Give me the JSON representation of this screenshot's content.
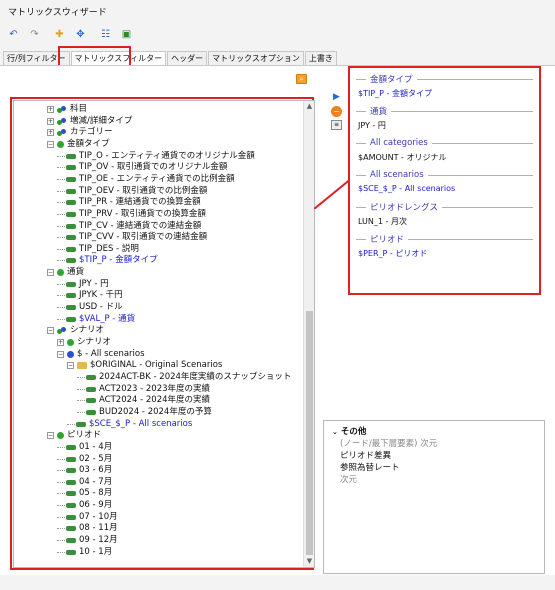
{
  "window": {
    "title": "マトリックスウィザード"
  },
  "toolbar": [
    {
      "name": "undo-icon",
      "glyph": "↶",
      "color": "#2a6ad0"
    },
    {
      "name": "redo-icon",
      "glyph": "↷",
      "color": "#888888"
    },
    {
      "name": "add-member-icon",
      "glyph": "✚",
      "color": "#e0a020"
    },
    {
      "name": "member-select-icon",
      "glyph": "✥",
      "color": "#2a6ad0"
    },
    {
      "name": "list-view-icon",
      "glyph": "☷",
      "color": "#2a6ad0"
    },
    {
      "name": "export-icon",
      "glyph": "▣",
      "color": "#2a8a2a"
    }
  ],
  "tabs": [
    {
      "label": "行/列フィルター",
      "active": false
    },
    {
      "label": "マトリックスフィルター",
      "active": true
    },
    {
      "label": "ヘッダー",
      "active": false
    },
    {
      "label": "マトリックスオプション",
      "active": false
    },
    {
      "label": "上書き",
      "active": false
    }
  ],
  "tree": {
    "rows": [
      {
        "level": 0,
        "exp": "⊞",
        "icon": "multi",
        "label": "科目",
        "blue": false
      },
      {
        "level": 0,
        "exp": "⊞",
        "icon": "multi",
        "label": "増減/詳細タイプ",
        "blue": false
      },
      {
        "level": 0,
        "exp": "⊞",
        "icon": "multi",
        "label": "カテゴリー",
        "blue": false
      },
      {
        "level": 0,
        "exp": "⊟",
        "icon": "ball",
        "label": "金額タイプ",
        "blue": false
      },
      {
        "level": 1,
        "exp": "",
        "icon": "leaf",
        "label": "TIP_O - エンティティ通貨でのオリジナル金額",
        "blue": false
      },
      {
        "level": 1,
        "exp": "",
        "icon": "leaf",
        "label": "TIP_OV - 取引通貨でのオリジナル金額",
        "blue": false
      },
      {
        "level": 1,
        "exp": "",
        "icon": "leaf",
        "label": "TIP_OE - エンティティ通貨での比例金額",
        "blue": false
      },
      {
        "level": 1,
        "exp": "",
        "icon": "leaf",
        "label": "TIP_OEV - 取引通貨での比例金額",
        "blue": false
      },
      {
        "level": 1,
        "exp": "",
        "icon": "leaf",
        "label": "TIP_PR - 連結通貨での換算金額",
        "blue": false
      },
      {
        "level": 1,
        "exp": "",
        "icon": "leaf",
        "label": "TIP_PRV - 取引通貨での換算金額",
        "blue": false
      },
      {
        "level": 1,
        "exp": "",
        "icon": "leaf",
        "label": "TIP_CV - 連結通貨での連結金額",
        "blue": false
      },
      {
        "level": 1,
        "exp": "",
        "icon": "leaf",
        "label": "TIP_CVV - 取引通貨での連結金額",
        "blue": false
      },
      {
        "level": 1,
        "exp": "",
        "icon": "leaf",
        "label": "TIP_DES - 説明",
        "blue": false
      },
      {
        "level": 1,
        "exp": "",
        "icon": "leaf",
        "label": "$TIP_P - 金額タイプ",
        "blue": true
      },
      {
        "level": 0,
        "exp": "⊟",
        "icon": "ball",
        "label": "通貨",
        "blue": false
      },
      {
        "level": 1,
        "exp": "",
        "icon": "leaf",
        "label": "JPY - 円",
        "blue": false
      },
      {
        "level": 1,
        "exp": "",
        "icon": "leaf",
        "label": "JPYK - 千円",
        "blue": false
      },
      {
        "level": 1,
        "exp": "",
        "icon": "leaf",
        "label": "USD - ドル",
        "blue": false
      },
      {
        "level": 1,
        "exp": "",
        "icon": "leaf",
        "label": "$VAL_P - 通貨",
        "blue": true
      },
      {
        "level": 0,
        "exp": "⊟",
        "icon": "multi",
        "label": "シナリオ",
        "blue": false
      },
      {
        "level": 1,
        "exp": "⊞",
        "icon": "ball",
        "label": "シナリオ",
        "blue": false
      },
      {
        "level": 1,
        "exp": "⊟",
        "icon": "ballblue",
        "label": "$ - All scenarios",
        "blue": false
      },
      {
        "level": 2,
        "exp": "⊟",
        "icon": "folder",
        "label": "$ORIGINAL - Original Scenarios",
        "blue": false
      },
      {
        "level": 3,
        "exp": "",
        "icon": "leaf",
        "label": "2024ACT-BK - 2024年度実績のスナップショット",
        "blue": false
      },
      {
        "level": 3,
        "exp": "",
        "icon": "leaf",
        "label": "ACT2023 - 2023年度の実績",
        "blue": false
      },
      {
        "level": 3,
        "exp": "",
        "icon": "leaf",
        "label": "ACT2024 - 2024年度の実績",
        "blue": false
      },
      {
        "level": 3,
        "exp": "",
        "icon": "leaf",
        "label": "BUD2024 - 2024年度の予算",
        "blue": false
      },
      {
        "level": 2,
        "exp": "",
        "icon": "leaf",
        "label": "$SCE_$_P - All scenarios",
        "blue": true
      },
      {
        "level": 0,
        "exp": "⊟",
        "icon": "ball",
        "label": "ピリオド",
        "blue": false
      },
      {
        "level": 1,
        "exp": "",
        "icon": "leaf",
        "label": "01 - 4月",
        "blue": false
      },
      {
        "level": 1,
        "exp": "",
        "icon": "leaf",
        "label": "02 - 5月",
        "blue": false
      },
      {
        "level": 1,
        "exp": "",
        "icon": "leaf",
        "label": "03 - 6月",
        "blue": false
      },
      {
        "level": 1,
        "exp": "",
        "icon": "leaf",
        "label": "04 - 7月",
        "blue": false
      },
      {
        "level": 1,
        "exp": "",
        "icon": "leaf",
        "label": "05 - 8月",
        "blue": false
      },
      {
        "level": 1,
        "exp": "",
        "icon": "leaf",
        "label": "06 - 9月",
        "blue": false
      },
      {
        "level": 1,
        "exp": "",
        "icon": "leaf",
        "label": "07 - 10月",
        "blue": false
      },
      {
        "level": 1,
        "exp": "",
        "icon": "leaf",
        "label": "08 - 11月",
        "blue": false
      },
      {
        "level": 1,
        "exp": "",
        "icon": "leaf",
        "label": "09 - 12月",
        "blue": false
      },
      {
        "level": 1,
        "exp": "",
        "icon": "leaf",
        "label": "10 - 1月",
        "blue": false
      }
    ]
  },
  "selected": {
    "groups": [
      {
        "header": "金額タイプ",
        "value": "$TIP_P - 金額タイプ",
        "blue": true
      },
      {
        "header": "通貨",
        "value": "JPY - 円",
        "blue": false
      },
      {
        "header": "All categories",
        "value": "$AMOUNT - オリジナル",
        "blue": false
      },
      {
        "header": "All scenarios",
        "value": "$SCE_$_P - All scenarios",
        "blue": true
      },
      {
        "header": "ピリオドレングス",
        "value": "LUN_1 - 月次",
        "blue": false
      },
      {
        "header": "ピリオド",
        "value": "$PER_P - ピリオド",
        "blue": true
      }
    ]
  },
  "other": {
    "header": "その他",
    "lines": [
      {
        "text": "(ノード/最下層要素) 次元",
        "gray": true
      },
      {
        "text": "ピリオド差異",
        "gray": false
      },
      {
        "text": "参照為替レート",
        "gray": false
      },
      {
        "text": "次元",
        "gray": true
      }
    ]
  },
  "colors": {
    "highlight": "#e02020",
    "link": "#1a1ad0",
    "accent_orange": "#f08020"
  }
}
